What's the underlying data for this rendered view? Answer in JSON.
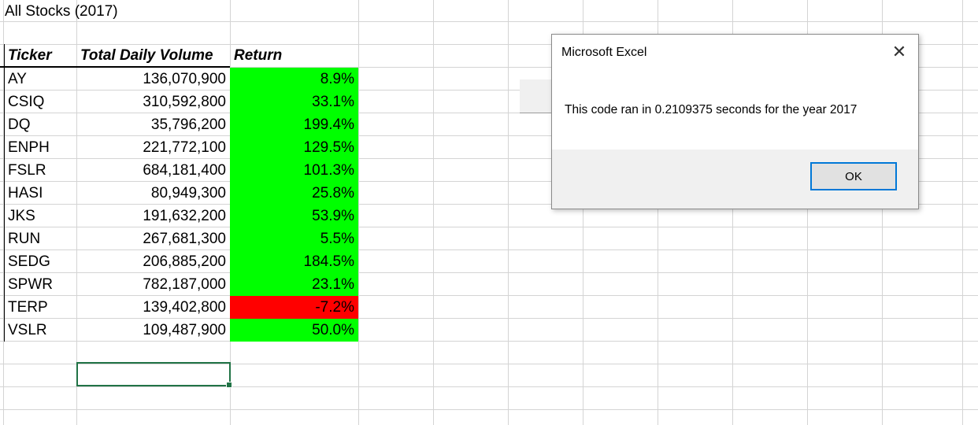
{
  "sheet": {
    "title": "All Stocks (2017)",
    "headers": {
      "ticker": "Ticker",
      "volume": "Total Daily Volume",
      "return": "Return"
    },
    "rows": [
      {
        "ticker": "AY",
        "volume": "136,070,900",
        "return": "8.9%",
        "status": "positive"
      },
      {
        "ticker": "CSIQ",
        "volume": "310,592,800",
        "return": "33.1%",
        "status": "positive"
      },
      {
        "ticker": "DQ",
        "volume": "35,796,200",
        "return": "199.4%",
        "status": "positive"
      },
      {
        "ticker": "ENPH",
        "volume": "221,772,100",
        "return": "129.5%",
        "status": "positive"
      },
      {
        "ticker": "FSLR",
        "volume": "684,181,400",
        "return": "101.3%",
        "status": "positive"
      },
      {
        "ticker": "HASI",
        "volume": "80,949,300",
        "return": "25.8%",
        "status": "positive"
      },
      {
        "ticker": "JKS",
        "volume": "191,632,200",
        "return": "53.9%",
        "status": "positive"
      },
      {
        "ticker": "RUN",
        "volume": "267,681,300",
        "return": "5.5%",
        "status": "positive"
      },
      {
        "ticker": "SEDG",
        "volume": "206,885,200",
        "return": "184.5%",
        "status": "positive"
      },
      {
        "ticker": "SPWR",
        "volume": "782,187,000",
        "return": "23.1%",
        "status": "positive"
      },
      {
        "ticker": "TERP",
        "volume": "139,402,800",
        "return": "-7.2%",
        "status": "negative"
      },
      {
        "ticker": "VSLR",
        "volume": "109,487,900",
        "return": "50.0%",
        "status": "positive"
      }
    ],
    "colors": {
      "positive": "#00ff00",
      "negative": "#ff0000",
      "selection": "#217346",
      "grid": "#d4d4d4"
    }
  },
  "dialog": {
    "title": "Microsoft Excel",
    "message": "This code ran in 0.2109375 seconds for the year 2017",
    "ok_label": "OK",
    "close_icon": "close-icon",
    "accent": "#0078d7"
  }
}
